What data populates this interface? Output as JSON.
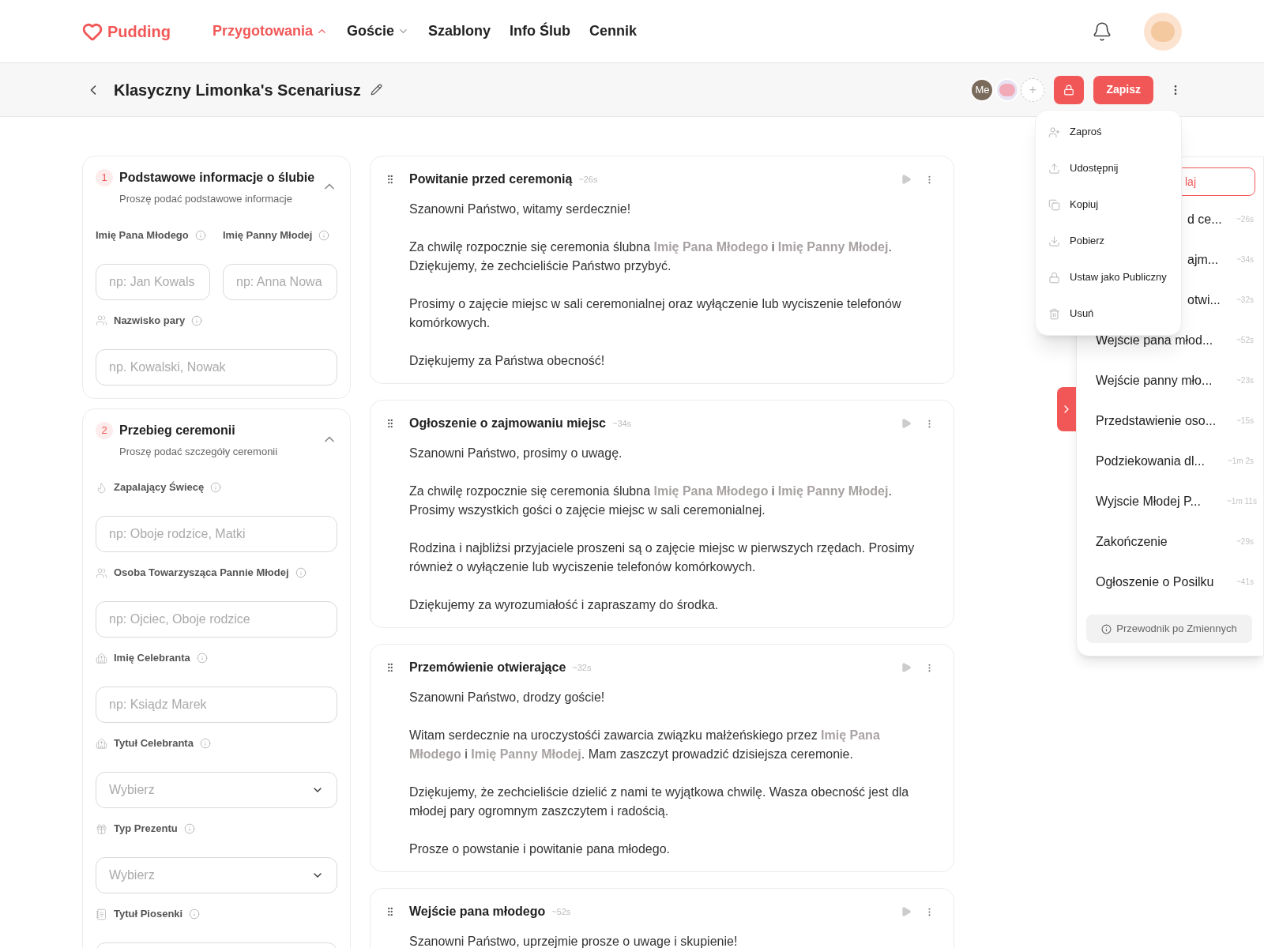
{
  "nav": {
    "logo": "Pudding",
    "items": [
      {
        "label": "Przygotowania",
        "selected": true,
        "expanded": true
      },
      {
        "label": "Goście",
        "selected": false,
        "expanded": false
      },
      {
        "label": "Szablony",
        "selected": false
      },
      {
        "label": "Info Ślub",
        "selected": false
      },
      {
        "label": "Cennik",
        "selected": false
      }
    ]
  },
  "header": {
    "title": "Klasyczny Limonka's Scenariusz",
    "collaborators": [
      {
        "kind": "initials",
        "text": "Me"
      },
      {
        "kind": "avatar"
      },
      {
        "kind": "add",
        "text": "+"
      }
    ],
    "save_button": "Zapisz"
  },
  "menu": [
    {
      "label": "Zaproś"
    },
    {
      "label": "Udostępnij"
    },
    {
      "label": "Kopiuj"
    },
    {
      "label": "Pobierz"
    },
    {
      "label": "Ustaw jako Publiczny"
    },
    {
      "label": "Usuń"
    }
  ],
  "form_sections": [
    {
      "number": "1",
      "title": "Podstawowe informacje o ślubie",
      "subtitle": "Proszę podać podstawowe informacje",
      "expanded": true,
      "fields": [
        {
          "kind": "pair",
          "items": [
            {
              "label": "Imię Pana Młodego",
              "placeholder": "np: Jan Kowals"
            },
            {
              "label": "Imię Panny Młodej",
              "placeholder": "np: Anna Nowa"
            }
          ]
        },
        {
          "kind": "input",
          "label": "Nazwisko pary",
          "placeholder": "np. Kowalski, Nowak"
        }
      ]
    },
    {
      "number": "2",
      "title": "Przebieg ceremonii",
      "subtitle": "Proszę podać szczegóły ceremonii",
      "expanded": true,
      "fields": [
        {
          "kind": "input",
          "label": "Zapalający Świecę",
          "placeholder": "np: Oboje rodzice, Matki"
        },
        {
          "kind": "input",
          "label": "Osoba Towarzysząca Pannie Młodej",
          "placeholder": "np: Ojciec, Oboje rodzice"
        },
        {
          "kind": "input",
          "label": "Imię Celebranta",
          "placeholder": "np: Ksiądz Marek"
        },
        {
          "kind": "select",
          "label": "Tytuł Celebranta",
          "placeholder": "Wybierz"
        },
        {
          "kind": "select",
          "label": "Typ Prezentu",
          "placeholder": "Wybierz"
        },
        {
          "kind": "input",
          "label": "Tytuł Piosenki"
        }
      ]
    }
  ],
  "script_sections": [
    {
      "title": "Powitanie przed ceremonią",
      "duration": "~26s",
      "paragraphs": [
        "Szanowni Państwo, witamy serdecznie!",
        "Za chwilę rozpocznie się ceremonia ślubna **Imię Pana Młodego** i **Imię Panny Młodej**. Dziękujemy, że zechcieliście Państwo przybyć.",
        "Prosimy o zajęcie miejsc w sali ceremonialnej oraz wyłączenie lub wyciszenie telefonów komórkowych.",
        "Dziękujemy za Państwa obecność!"
      ]
    },
    {
      "title": "Ogłoszenie o zajmowaniu miejsc",
      "duration": "~34s",
      "paragraphs": [
        "Szanowni Państwo, prosimy o uwagę.",
        "Za chwilę rozpocznie się ceremonia ślubna **Imię Pana Młodego** i **Imię Panny Młodej**. Prosimy wszystkich gości o zajęcie miejsc w sali ceremonialnej.",
        "Rodzina i najbliżsi przyjaciele proszeni są o zajęcie miejsc w pierwszych rzędach. Prosimy również o wyłączenie lub wyciszenie telefonów komórkowych.",
        "Dziękujemy za wyrozumiałość i zapraszamy do środka."
      ]
    },
    {
      "title": "Przemówienie otwierające",
      "duration": "~32s",
      "paragraphs": [
        "Szanowni Państwo, drodzy goście!",
        "Witam serdecznie na uroczystośći zawarcia związku małżeńskiego przez **Imię Pana Młodego** i **Imię Panny Młodej**. Mam zaszczyt prowadzić dzisiejsza ceremonie.",
        "Dziękujemy, że zechcieliście dzielić z nami te wyjątkowa chwilę. Wasza obecność jest dla młodej pary ogromnym zaszczytem i radością.",
        "Prosze o powstanie i powitanie pana młodego."
      ]
    },
    {
      "title": "Wejście pana młodego",
      "duration": "~52s",
      "paragraphs": [
        "Szanowni Państwo, uprzejmie prosze o uwage i skupienie!"
      ]
    }
  ],
  "outline": {
    "add_button": "laj",
    "items": [
      {
        "kind": "covered",
        "label": "d ce...",
        "duration": "~26s"
      },
      {
        "kind": "covered",
        "label": "ajm...",
        "duration": "~34s"
      },
      {
        "kind": "covered",
        "label": "otwi...",
        "duration": "~32s"
      },
      {
        "kind": "item",
        "label": "Wejście pana młod...",
        "duration": "~52s"
      },
      {
        "kind": "item",
        "label": "Wejście panny mło...",
        "duration": "~23s"
      },
      {
        "kind": "item",
        "label": "Przedstawienie oso...",
        "duration": "~15s"
      },
      {
        "kind": "item",
        "label": "Podziekowania dl...",
        "duration": "~1m 2s"
      },
      {
        "kind": "item",
        "label": "Wyjscie Młodej P...",
        "duration": "~1m 11s"
      },
      {
        "kind": "item",
        "label": "Zakończenie",
        "duration": "~29s"
      },
      {
        "kind": "item",
        "label": "Ogłoszenie o Posilku",
        "duration": "~41s"
      }
    ],
    "guide_button": "Przewodnik po Zmiennych"
  }
}
